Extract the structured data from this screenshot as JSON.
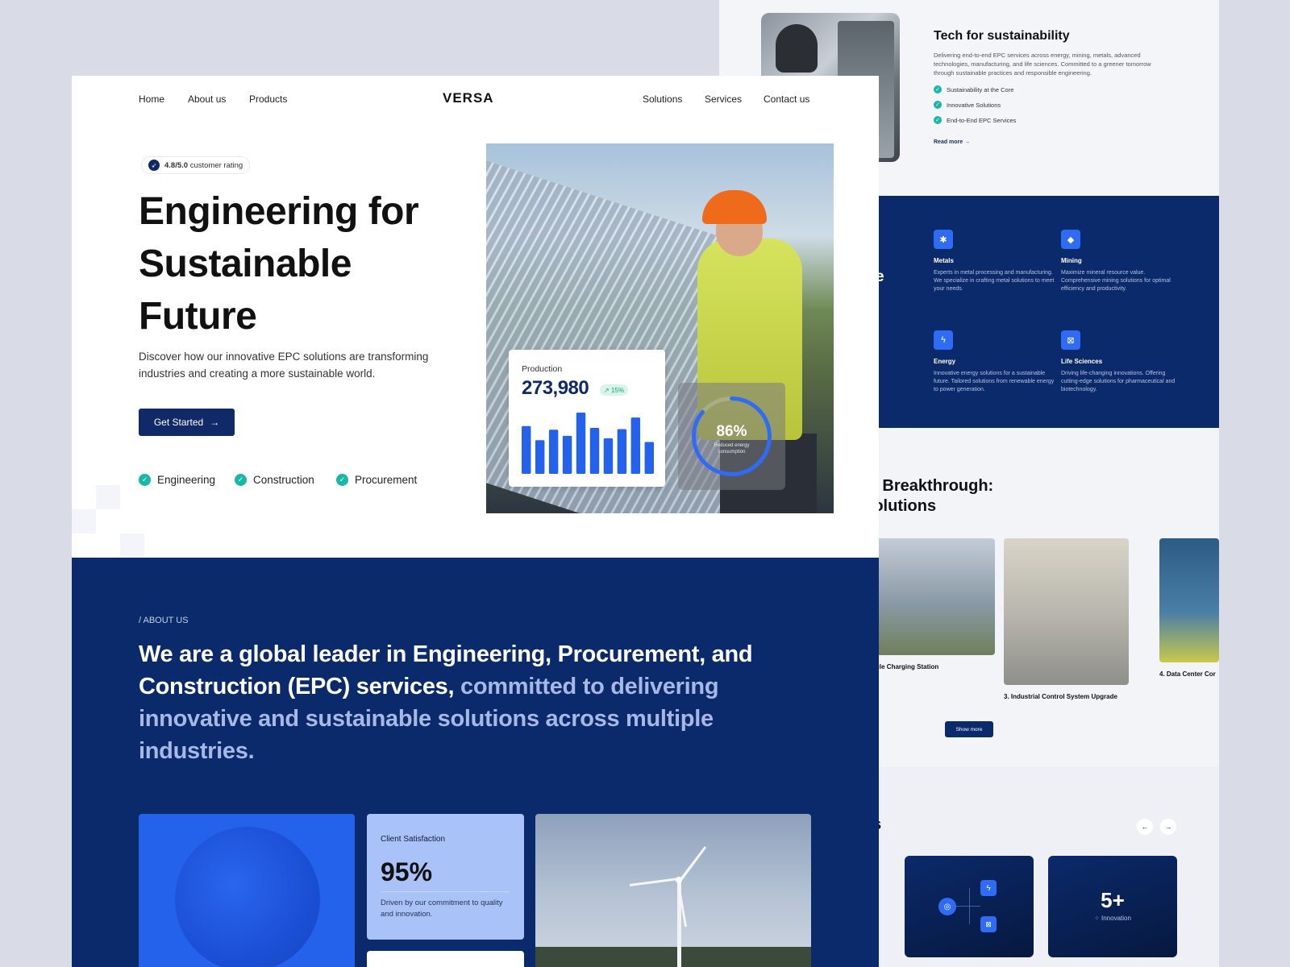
{
  "nav": {
    "home": "Home",
    "about": "About us",
    "products": "Products",
    "logo": "VERSA",
    "solutions": "Solutions",
    "services": "Services",
    "contact": "Contact us"
  },
  "hero": {
    "rating": "4.8/5.0",
    "rating_suffix": "customer rating",
    "title": "Engineering for Sustainable Future",
    "subtitle": "Discover how our innovative EPC solutions are transforming industries and creating a more sustainable world.",
    "cta": "Get Started",
    "tags": [
      "Engineering",
      "Construction",
      "Procurement"
    ]
  },
  "production_card": {
    "label": "Production",
    "value": "273,980",
    "badge": "↗ 15%",
    "bars": [
      0.78,
      0.55,
      0.72,
      0.62,
      1.0,
      0.75,
      0.58,
      0.73,
      0.92,
      0.52
    ]
  },
  "energy_ring": {
    "value": "86%",
    "fraction": 0.86,
    "label": "Reduced energy consumption"
  },
  "about": {
    "tag": "/ ABOUT US",
    "text_strong": "We are a global leader in Engineering, Procurement, and Construction (EPC) services,",
    "text_muted": "committed to delivering innovative and sustainable solutions across multiple industries.",
    "satisfaction_label": "Client Satisfaction",
    "satisfaction_value": "95%",
    "satisfaction_desc": "Driven by our commitment to quality and innovation."
  },
  "tech": {
    "title": "Tech for sustainability",
    "desc": "Delivering end-to-end EPC services across energy, mining, metals, advanced technologies, manufacturing, and life sciences. Committed to a greener tomorrow through sustainable practices and responsible engineering.",
    "checks": [
      "Sustainability at the Core",
      "Innovative Solutions",
      "End-to-End EPC Services"
    ],
    "read_more": "Read more"
  },
  "industries": {
    "peek": "rve",
    "items": [
      {
        "name": "Metals",
        "desc": "Experts in metal processing and manufacturing. We specialize in crafting metal solutions to meet your needs.",
        "icon": "gear-icon"
      },
      {
        "name": "Mining",
        "desc": "Maximize mineral resource value. Comprehensive mining solutions for optimal efficiency and productivity.",
        "icon": "gem-icon"
      },
      {
        "name": "Energy",
        "desc": "Innovative energy solutions for a sustainable future. Tailored solutions from renewable energy to power generation.",
        "icon": "bolt-icon"
      },
      {
        "name": "Life Sciences",
        "desc": "Driving life-changing innovations. Offering cutting-edge solutions for pharmaceutical and biotechnology.",
        "icon": "grid-icon"
      }
    ]
  },
  "breakthrough": {
    "title_line1": "to Breakthrough:",
    "title_line2": "Solutions",
    "projects": [
      "Vehicle Charging Station",
      "3.  Industrial Control System Upgrade",
      "4.  Data Center Cor"
    ],
    "show_more": "Show more"
  },
  "bottom": {
    "peek": "es",
    "prev": "←",
    "next": "→",
    "five_value": "5+",
    "five_label": "Innovation"
  },
  "colors": {
    "navy": "#0b2a6b",
    "blue": "#2462ec",
    "teal": "#19b7a6"
  }
}
